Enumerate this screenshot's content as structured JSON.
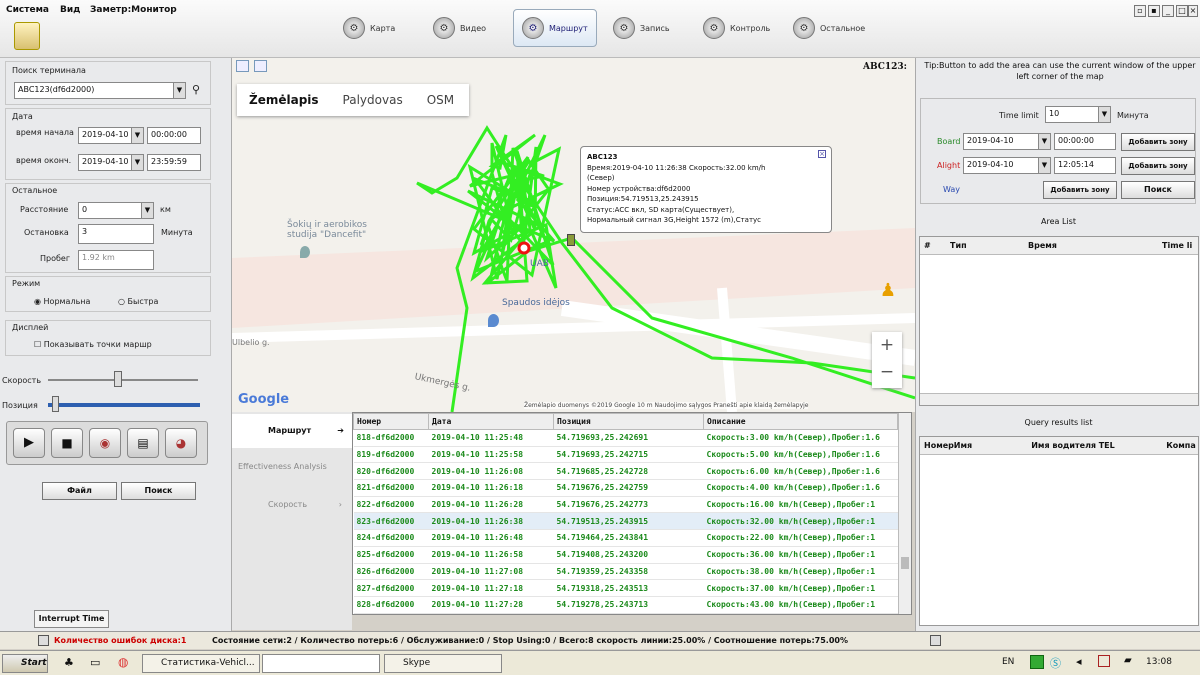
{
  "menu": {
    "system": "Система",
    "view": "Вид",
    "params": "Заметр:Монитор"
  },
  "nav": {
    "map": "Карта",
    "video": "Видео",
    "route": "Маршрут",
    "record": "Запись",
    "control": "Контроль",
    "other": "Остальное"
  },
  "left": {
    "search_label": "Поиск терминала",
    "terminal": "ABC123(df6d2000)",
    "date_group": "Дата",
    "start_label": "время начала",
    "start_date": "2019-04-10",
    "start_time": "00:00:00",
    "end_label": "время оконч.",
    "end_date": "2019-04-10",
    "end_time": "23:59:59",
    "other_group": "Остальное",
    "distance_label": "Расстояние",
    "distance_value": "0",
    "distance_unit": "км",
    "stop_label": "Остановка",
    "stop_value": "3",
    "stop_unit": "Минута",
    "mileage_label": "Пробег",
    "mileage_value": "1.92 km",
    "mode_group": "Режим",
    "mode_normal": "Нормальна",
    "mode_fast": "Быстра",
    "display_group": "Дисплей",
    "show_points": "Показывать точки маршр",
    "speed_label": "Скорость",
    "position_label": "Позиция",
    "file_btn": "Файл",
    "search_btn": "Поиск",
    "interrupt_tab": "Interrupt Time"
  },
  "map": {
    "title": "ABC123:",
    "tabs": [
      "Žemėlapis",
      "Palydovas",
      "OSM"
    ],
    "place1": "Šokių ir aerobikos studija \"Dancefit\"",
    "place2": "Spaudos idėjos",
    "place3": "UAB",
    "street1": "Ulbelio g.",
    "street2": "Ukmergės g.",
    "google": "Google",
    "copyright": "Žemėlapio duomenys ©2019 Google   10 m   Naudojimo sąlygos   Pranešti apie klaidą žemėlapyje",
    "popup": {
      "l1": "ABC123",
      "l2": "Время:2019-04-10 11:26:38    Скорость:32.00 km/h",
      "l3": "(Север)",
      "l4": "Номер устройства:df6d2000",
      "l5": "Позиция:54.719513,25.243915",
      "l6": "Статус:ACC вкл, SD карта(Существует),",
      "l7": "Нормальный сигнал 3G,Height 1572 (m),Статус"
    }
  },
  "tabs_left": {
    "route": "Маршрут",
    "efficiency": "Effectiveness Analysis",
    "speed": "Скорость"
  },
  "table": {
    "headers": [
      "Номер",
      "Дата",
      "Позиция",
      "Описание"
    ],
    "rows": [
      [
        "818-df6d2000",
        "2019-04-10 11:25:48",
        "54.719693,25.242691",
        "Скорость:3.00 km/h(Север),Пробег:1.6"
      ],
      [
        "819-df6d2000",
        "2019-04-10 11:25:58",
        "54.719693,25.242715",
        "Скорость:5.00 km/h(Север),Пробег:1.6"
      ],
      [
        "820-df6d2000",
        "2019-04-10 11:26:08",
        "54.719685,25.242728",
        "Скорость:6.00 km/h(Север),Пробег:1.6"
      ],
      [
        "821-df6d2000",
        "2019-04-10 11:26:18",
        "54.719676,25.242759",
        "Скорость:4.00 km/h(Север),Пробег:1.6"
      ],
      [
        "822-df6d2000",
        "2019-04-10 11:26:28",
        "54.719676,25.242773",
        "Скорость:16.00 km/h(Север),Пробег:1"
      ],
      [
        "823-df6d2000",
        "2019-04-10 11:26:38",
        "54.719513,25.243915",
        "Скорость:32.00 km/h(Север),Пробег:1"
      ],
      [
        "824-df6d2000",
        "2019-04-10 11:26:48",
        "54.719464,25.243841",
        "Скорость:22.00 km/h(Север),Пробег:1"
      ],
      [
        "825-df6d2000",
        "2019-04-10 11:26:58",
        "54.719408,25.243200",
        "Скорость:36.00 km/h(Север),Пробег:1"
      ],
      [
        "826-df6d2000",
        "2019-04-10 11:27:08",
        "54.719359,25.243358",
        "Скорость:38.00 km/h(Север),Пробег:1"
      ],
      [
        "827-df6d2000",
        "2019-04-10 11:27:18",
        "54.719318,25.243513",
        "Скорость:37.00 km/h(Север),Пробег:1"
      ],
      [
        "828-df6d2000",
        "2019-04-10 11:27:28",
        "54.719278,25.243713",
        "Скорость:43.00 km/h(Север),Пробег:1"
      ]
    ]
  },
  "right": {
    "tip": "Tip:Button to add the area can use the current window of the upper left corner of the map",
    "time_limit": "Time limit",
    "time_limit_value": "10",
    "minute": "Минута",
    "board": "Board",
    "board_date": "2019-04-10",
    "board_time": "00:00:00",
    "alight": "Alight",
    "alight_date": "2019-04-10",
    "alight_time": "12:05:14",
    "way": "Way",
    "add_zone": "Добавить зону",
    "search": "Поиск",
    "area_list": "Area List",
    "area_headers": [
      "#",
      "Тип",
      "Время",
      "Time li"
    ],
    "query_list": "Query results list",
    "query_headers": [
      "Номер",
      "Имя",
      "Имя водителя",
      "TEL",
      "Компа"
    ]
  },
  "status": {
    "errors": "Количество ошибок диска:1",
    "rest": "Состояние сети:2 / Количество потерь:6 / Обслуживание:0 / Stop Using:0 / Всего:8    скорость линии:25.00% / Соотношение потерь:75.00%"
  },
  "taskbar": {
    "start": "Start",
    "app1": "Статистика-Vehicl...",
    "app2": "",
    "app3": "Skype",
    "lang": "EN",
    "time": "13:08"
  },
  "colors": {
    "route": "#33ee22",
    "accent": "#2a6db3"
  }
}
